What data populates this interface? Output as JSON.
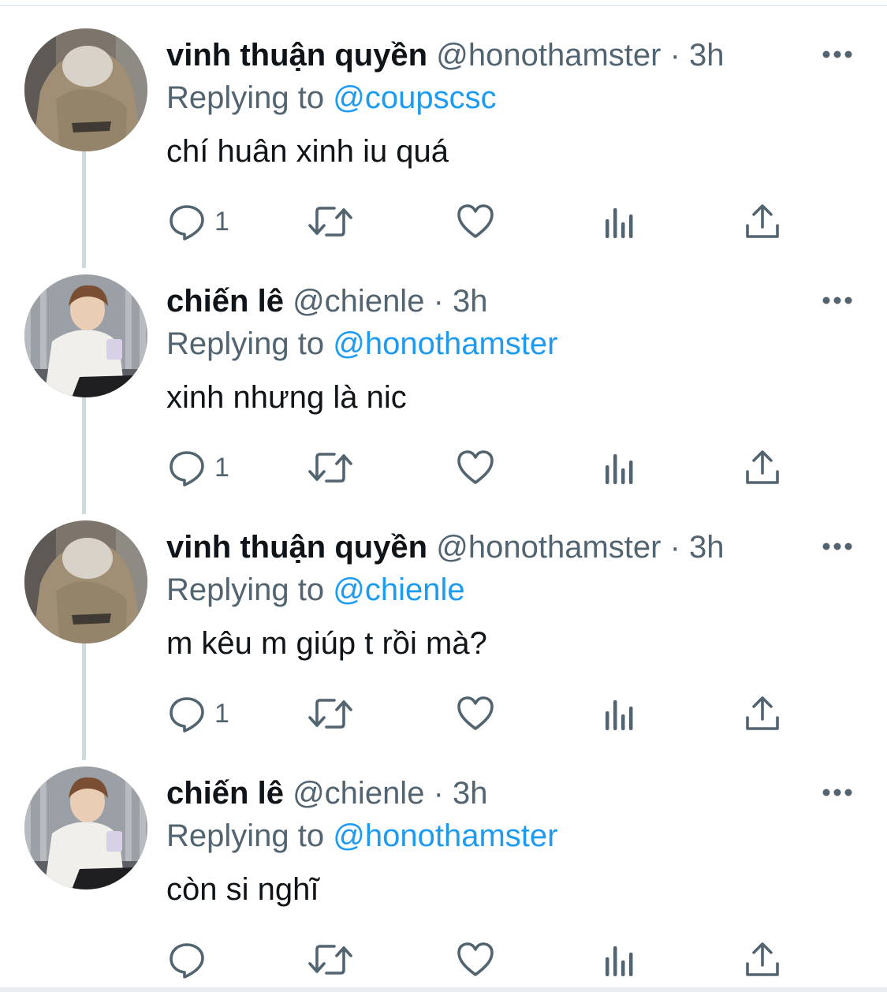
{
  "tweets": [
    {
      "name": "vinh thuận quyền",
      "handle": "@honothamster",
      "time": "· 3h",
      "replying_prefix": "Replying to",
      "replying_to": "@coupscsc",
      "text": "chí huân xinh iu quá",
      "reply_count": "1",
      "avatar": "avatar-hoodie-photo"
    },
    {
      "name": "chiến lê",
      "handle": "@chienle",
      "time": "· 3h",
      "replying_prefix": "Replying to",
      "replying_to": "@honothamster",
      "text": "xinh nhưng là nic",
      "reply_count": "1",
      "avatar": "avatar-white-shirt-photo"
    },
    {
      "name": "vinh thuận quyền",
      "handle": "@honothamster",
      "time": "· 3h",
      "replying_prefix": "Replying to",
      "replying_to": "@chienle",
      "text": "m kêu m giúp t rồi mà?",
      "reply_count": "1",
      "avatar": "avatar-hoodie-photo"
    },
    {
      "name": "chiến lê",
      "handle": "@chienle",
      "time": "· 3h",
      "replying_prefix": "Replying to",
      "replying_to": "@honothamster",
      "text": "còn si nghĩ",
      "reply_count": "",
      "avatar": "avatar-white-shirt-photo"
    }
  ],
  "icons": {
    "reply": "reply-icon",
    "retweet": "retweet-icon",
    "like": "heart-icon",
    "analytics": "analytics-icon",
    "share": "share-icon",
    "more": "more-icon"
  },
  "colors": {
    "text": "#0f1419",
    "secondary": "#536471",
    "link": "#1d9bf0",
    "thread_line": "#cfd9de"
  }
}
